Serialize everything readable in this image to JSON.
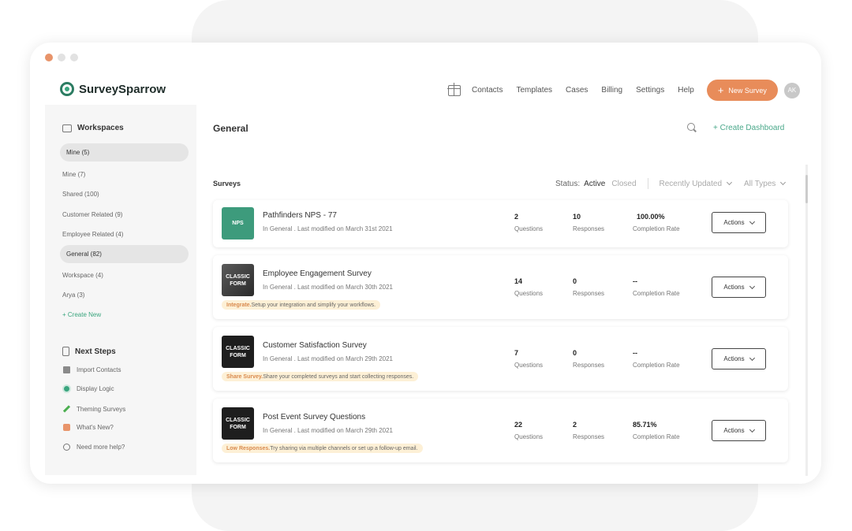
{
  "app": {
    "name": "SurveySparrow"
  },
  "topnav": {
    "links": [
      "Contacts",
      "Templates",
      "Cases",
      "Billing",
      "Settings",
      "Help"
    ],
    "new_survey_label": "New Survey",
    "avatar_initials": "AK"
  },
  "sidebar": {
    "workspaces_title": "Workspaces",
    "items": [
      {
        "label": "Mine (5)",
        "selected": true
      },
      {
        "label": "Mine (7)",
        "selected": false
      },
      {
        "label": "Shared (100)",
        "selected": false
      },
      {
        "label": "Customer Related (9)",
        "selected": false
      },
      {
        "label": "Employee Related (4)",
        "selected": false
      },
      {
        "label": "General (82)",
        "selected": true
      },
      {
        "label": "Workspace (4)",
        "selected": false
      },
      {
        "label": "Arya (3)",
        "selected": false
      }
    ],
    "create_new": "Create New",
    "next_steps_title": "Next Steps",
    "next_steps": [
      "Import Contacts",
      "Display Logic",
      "Theming Surveys",
      "What's New?",
      "Need more help?"
    ]
  },
  "main": {
    "title": "General",
    "create_dashboard": "Create Dashboard",
    "surveys_label": "Surveys",
    "filters": {
      "status_label": "Status:",
      "active": "Active",
      "closed": "Closed",
      "sort": "Recently Updated",
      "type": "All Types"
    },
    "surveys": [
      {
        "thumb": "NPS",
        "title": "Pathfinders NPS - 77",
        "subtitle": "In General . Last modified on March 31st 2021",
        "questions": "2",
        "responses": "10",
        "completion": "100.00%",
        "tip_bold": "",
        "tip_text": ""
      },
      {
        "thumb": "CLASSIC FORM",
        "title": "Employee Engagement Survey",
        "subtitle": "In General . Last modified on March 30th 2021",
        "questions": "14",
        "responses": "0",
        "completion": "--",
        "tip_bold": "Integrate.",
        "tip_text": " Setup your integration and simplify your workflows."
      },
      {
        "thumb": "CLASSIC FORM",
        "title": "Customer Satisfaction Survey",
        "subtitle": "In General . Last modified on March 29th 2021",
        "questions": "7",
        "responses": "0",
        "completion": "--",
        "tip_bold": "Share Survey.",
        "tip_text": " Share your completed surveys and start collecting responses."
      },
      {
        "thumb": "CLASSIC FORM",
        "title": "Post Event Survey Questions",
        "subtitle": "In General . Last modified on March 29th 2021",
        "questions": "22",
        "responses": "2",
        "completion": "85.71%",
        "tip_bold": "Low Responses.",
        "tip_text": " Try sharing via multiple channels or set up a follow-up email."
      }
    ],
    "labels": {
      "questions": "Questions",
      "responses": "Responses",
      "completion": "Completion Rate",
      "actions": "Actions"
    }
  }
}
